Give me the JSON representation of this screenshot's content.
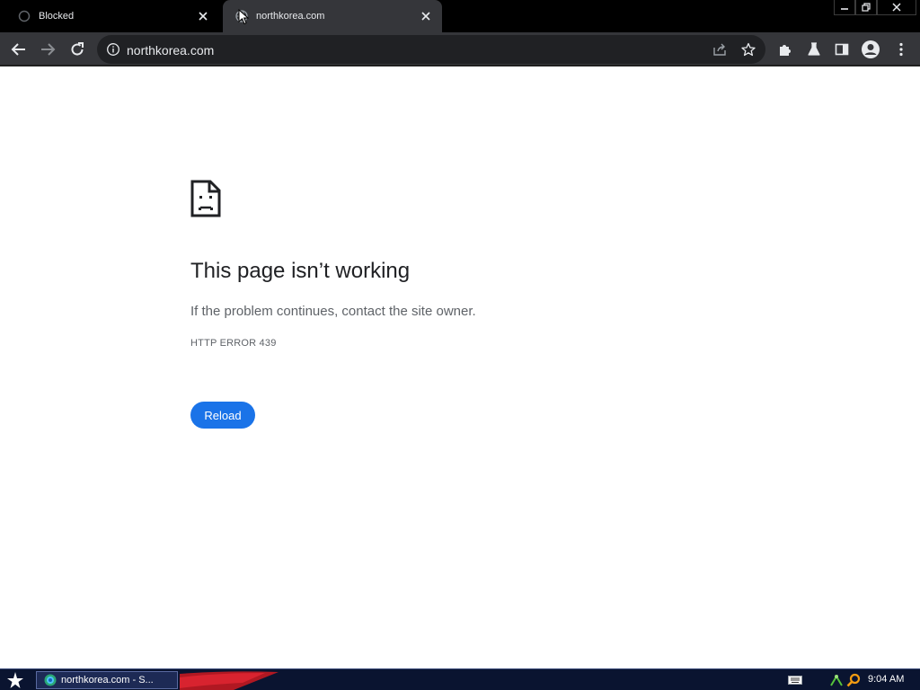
{
  "browser": {
    "tabs": [
      {
        "title": "Blocked",
        "active": false
      },
      {
        "title": "northkorea.com",
        "active": true
      }
    ],
    "address": "northkorea.com",
    "colors": {
      "frame": "#000000",
      "toolbar": "#35363a",
      "omnibox": "#202124",
      "accent": "#1a73e8"
    },
    "icons": [
      "back-arrow-icon",
      "forward-arrow-icon",
      "reload-icon",
      "info-icon",
      "share-icon",
      "star-icon",
      "extensions-icon",
      "labs-flask-icon",
      "side-panel-icon",
      "profile-avatar-icon",
      "menu-kebab-icon"
    ]
  },
  "error_page": {
    "title": "This page isn’t working",
    "message": "If the problem continues, contact the site owner.",
    "code": "HTTP ERROR 439",
    "reload_label": "Reload"
  },
  "taskbar": {
    "task_label": "northkorea.com - S...",
    "clock": "9:04 AM"
  }
}
